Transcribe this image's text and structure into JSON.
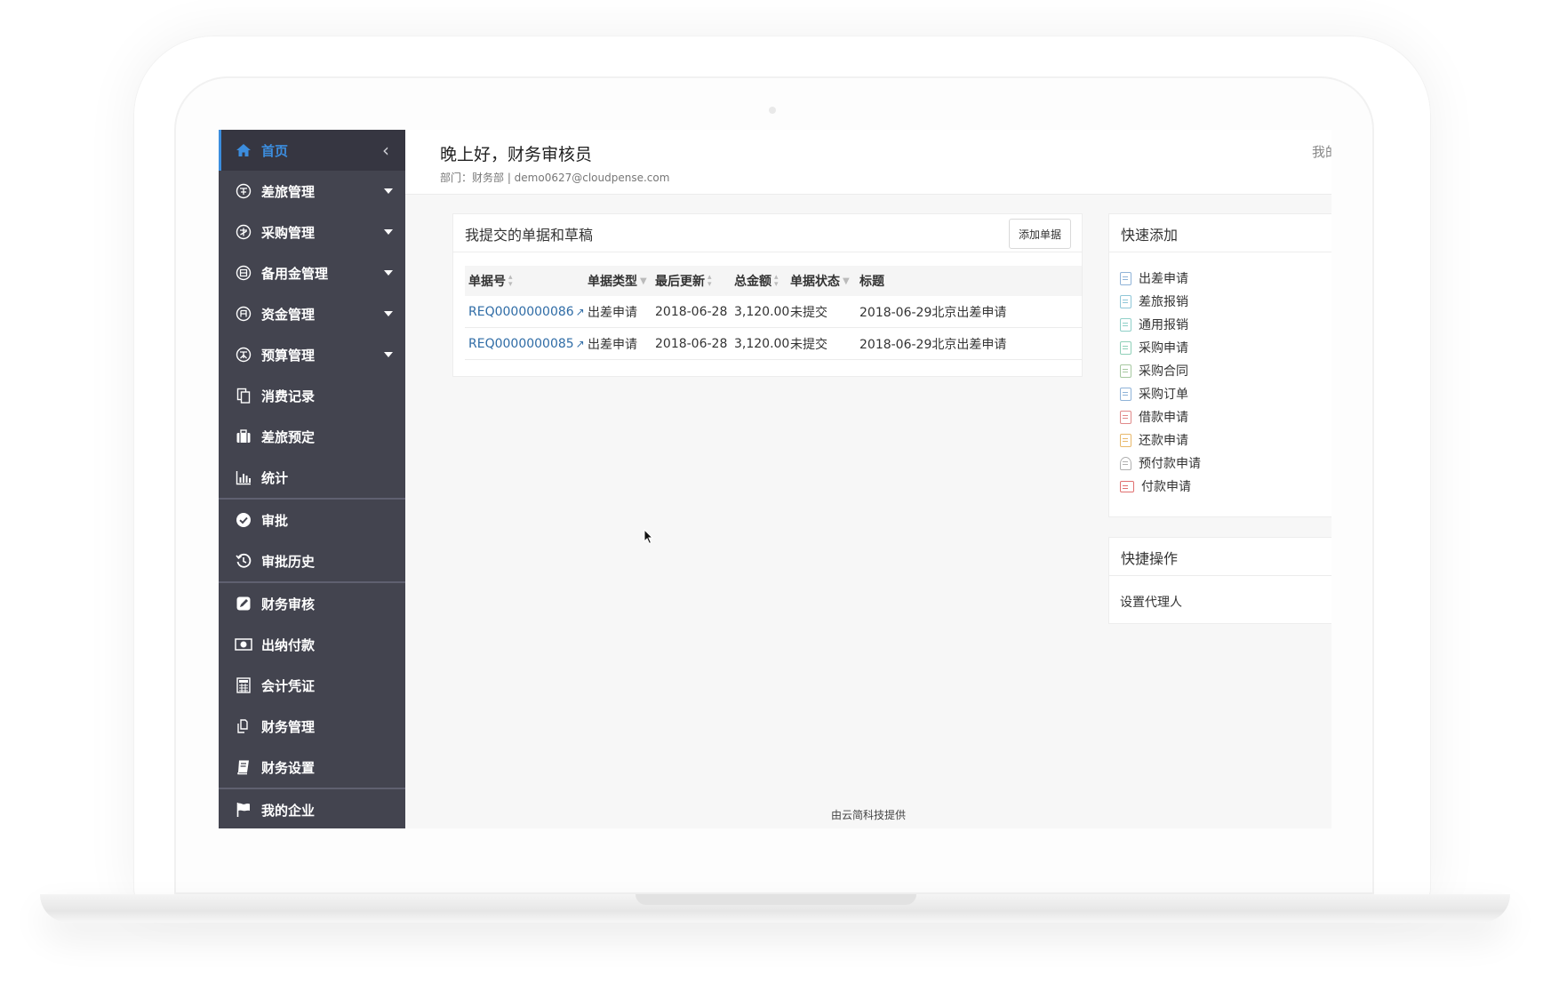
{
  "sidebar": {
    "items": [
      {
        "label": "首页",
        "icon": "home-icon"
      },
      {
        "label": "差旅管理",
        "icon": "circle-char-icon"
      },
      {
        "label": "采购管理",
        "icon": "circle-char-icon"
      },
      {
        "label": "备用金管理",
        "icon": "circle-char-icon"
      },
      {
        "label": "资金管理",
        "icon": "circle-char-icon"
      },
      {
        "label": "预算管理",
        "icon": "circle-char-icon"
      },
      {
        "label": "消费记录",
        "icon": "documents-icon"
      },
      {
        "label": "差旅预定",
        "icon": "suitcase-icon"
      },
      {
        "label": "统计",
        "icon": "bar-chart-icon"
      },
      {
        "label": "审批",
        "icon": "check-circle-icon"
      },
      {
        "label": "审批历史",
        "icon": "history-icon"
      },
      {
        "label": "财务审核",
        "icon": "edit-icon"
      },
      {
        "label": "出纳付款",
        "icon": "money-icon"
      },
      {
        "label": "会计凭证",
        "icon": "calculator-icon"
      },
      {
        "label": "财务管理",
        "icon": "copy-icon"
      },
      {
        "label": "财务设置",
        "icon": "book-icon"
      },
      {
        "label": "我的企业",
        "icon": "flag-icon"
      }
    ],
    "collapse_glyph": "‹"
  },
  "header": {
    "greeting": "晚上好，财务审核员",
    "dept": "部门：财务部 | demo0627@cloudpense.com",
    "right_text": "我的"
  },
  "submitted": {
    "title": "我提交的单据和草稿",
    "add_button": "添加单据",
    "columns": [
      "单据号",
      "单据类型",
      "最后更新",
      "总金额",
      "单据状态",
      "标题"
    ],
    "rows": [
      {
        "id": "REQ0000000086",
        "type": "出差申请",
        "updated": "2018-06-28",
        "amount": "3,120.00",
        "status": "未提交",
        "title": "2018-06-29北京出差申请"
      },
      {
        "id": "REQ0000000085",
        "type": "出差申请",
        "updated": "2018-06-28",
        "amount": "3,120.00",
        "status": "未提交",
        "title": "2018-06-29北京出差申请"
      }
    ]
  },
  "quick_add": {
    "title": "快速添加",
    "items": [
      {
        "label": "出差申请",
        "color": "#8fb3d8"
      },
      {
        "label": "差旅报销",
        "color": "#8fc7d8"
      },
      {
        "label": "通用报销",
        "color": "#8fd0c8"
      },
      {
        "label": "采购申请",
        "color": "#8fd0b8"
      },
      {
        "label": "采购合同",
        "color": "#a6c8a0"
      },
      {
        "label": "采购订单",
        "color": "#8fb3d8"
      },
      {
        "label": "借款申请",
        "color": "#e08a8a"
      },
      {
        "label": "还款申请",
        "color": "#e8b86a"
      },
      {
        "label": "预付款申请",
        "color": "#b0b0b0"
      },
      {
        "label": "付款申请",
        "color": "#e07070"
      }
    ]
  },
  "quick_ops": {
    "title": "快捷操作",
    "items": [
      "设置代理人"
    ]
  },
  "footer": "由云简科技提供"
}
